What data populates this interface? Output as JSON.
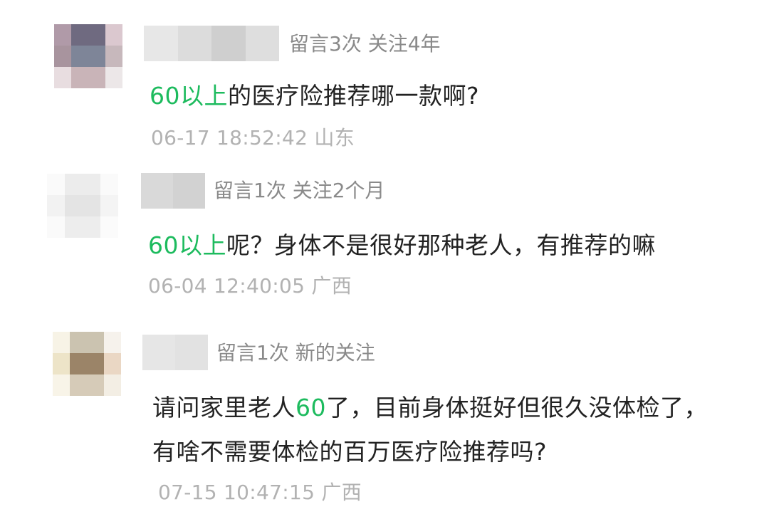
{
  "comments": [
    {
      "stats": "留言3次 关注4年",
      "text_parts": [
        {
          "text": "60以上",
          "highlight": true
        },
        {
          "text": "的医疗险推荐哪一款啊?",
          "highlight": false
        }
      ],
      "time": "06-17 18:52:42 山东",
      "avatar_colors": [
        "#b09aa8",
        "#6f6a80",
        "#6f6a80",
        "#dbc8cf",
        "#a8949e",
        "#7e8598",
        "#7e8598",
        "#c7b8bc",
        "#e8dde0",
        "#c9b4b8",
        "#c9b4b8",
        "#ece7e8"
      ],
      "nick_colors": [
        "#e7e7e7",
        "#dcdcdc",
        "#cfcfcf",
        "#dedede"
      ]
    },
    {
      "stats": "留言1次 关注2个月",
      "text_parts": [
        {
          "text": "60以上",
          "highlight": true
        },
        {
          "text": "呢？身体不是很好那种老人，有推荐的嘛",
          "highlight": false
        }
      ],
      "time": "06-04 12:40:05 广西",
      "avatar_colors": [
        "#fafafa",
        "#ececec",
        "#ececec",
        "#fafafa",
        "#f2f2f2",
        "#e4e4e4",
        "#e4e4e4",
        "#f4f4f4",
        "#fafafa",
        "#ededed",
        "#ededed",
        "#fbfbfb"
      ],
      "nick_colors": [
        "#d9d9d9",
        "#d2d2d2"
      ]
    },
    {
      "stats": "留言1次 新的关注",
      "text_lines": [
        [
          {
            "text": "请问家里老人",
            "highlight": false
          },
          {
            "text": "60",
            "highlight": true
          },
          {
            "text": "了，目前身体挺好但很久没体检了，",
            "highlight": false
          }
        ],
        [
          {
            "text": "有啥不需要体检的百万医疗险推荐吗?",
            "highlight": false
          }
        ]
      ],
      "time": "07-15 10:47:15 广西",
      "avatar_colors": [
        "#f7f3e6",
        "#cbc3b0",
        "#cbc3b0",
        "#f6f2ec",
        "#ede4c8",
        "#9b8468",
        "#9b8468",
        "#ead7c4",
        "#f8f4e8",
        "#d6cbb8",
        "#d6cbb8",
        "#f3eee4"
      ],
      "nick_colors": [
        "#e6e6e6",
        "#e2e2e2"
      ]
    }
  ]
}
